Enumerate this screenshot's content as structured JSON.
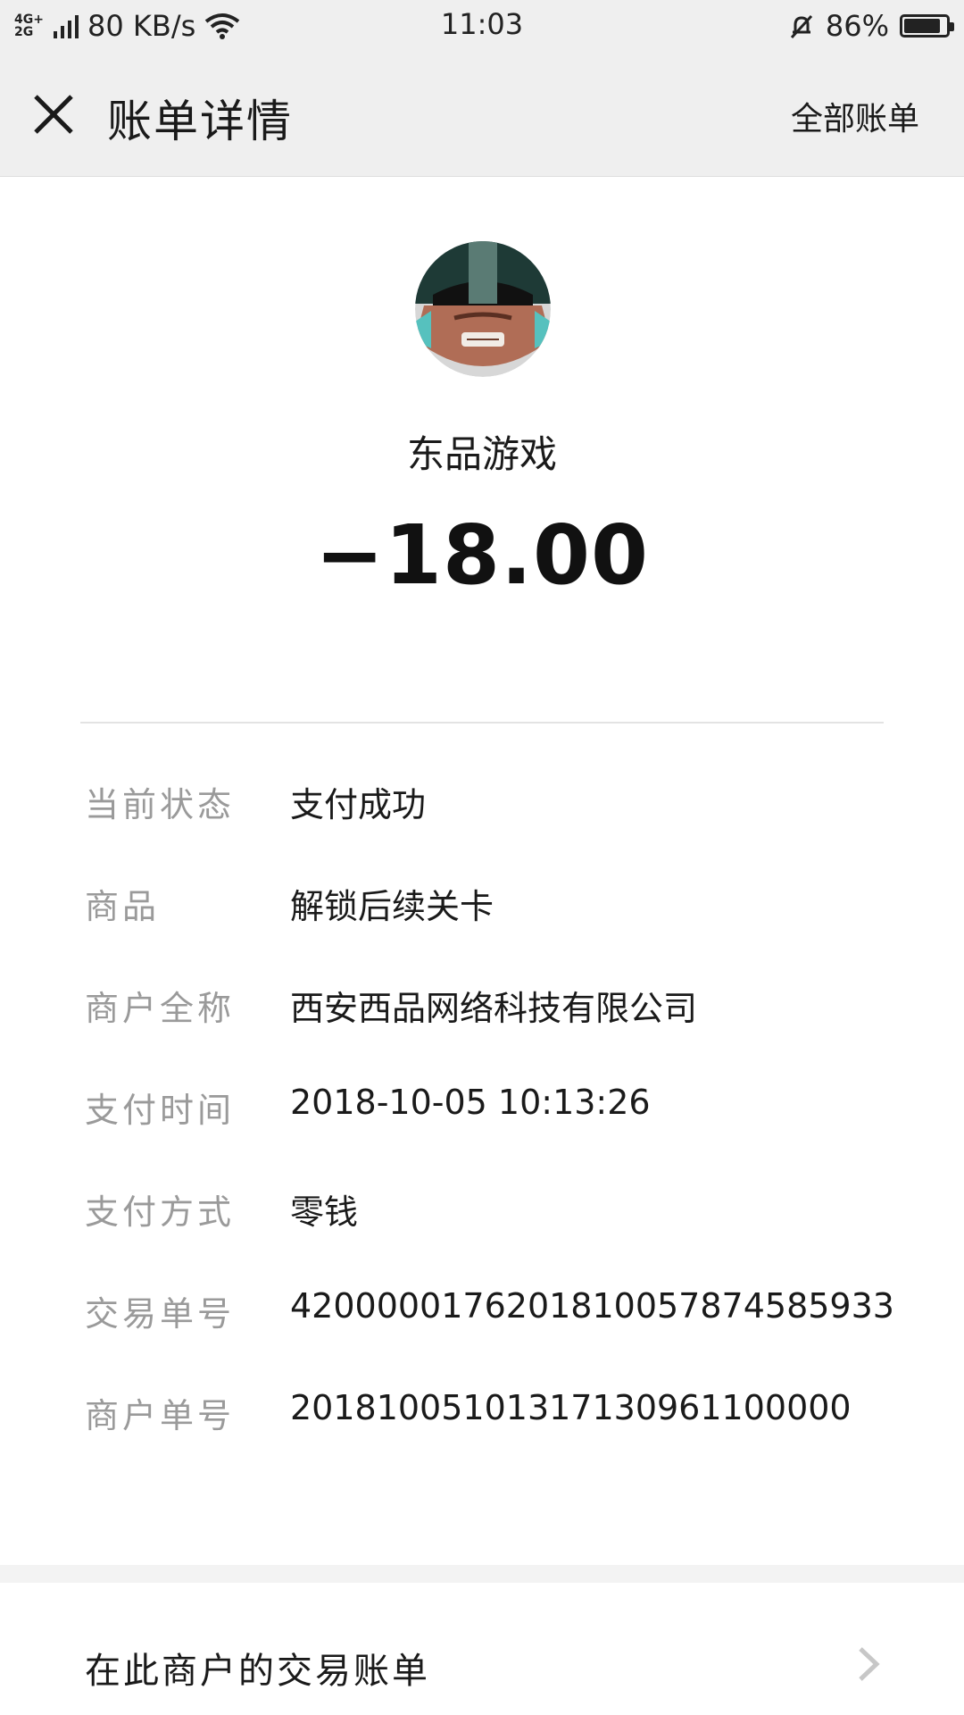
{
  "status_bar": {
    "network_top": "4G+",
    "network_bottom": "2G",
    "speed": "80 KB/s",
    "time": "11:03",
    "battery_percent": "86%",
    "battery_level": 0.86,
    "icons": [
      "signal-icon",
      "wifi-icon",
      "mute-bell-icon",
      "battery-icon"
    ]
  },
  "nav": {
    "title": "账单详情",
    "all_bills": "全部账单",
    "close_icon": "close-icon"
  },
  "merchant": {
    "name": "东品游戏",
    "amount": "−18.00",
    "avatar_icon": "merchant-avatar"
  },
  "details": [
    {
      "label": "当前状态",
      "value": "支付成功"
    },
    {
      "label": "商品",
      "value": "解锁后续关卡"
    },
    {
      "label": "商户全称",
      "value": "西安西品网络科技有限公司"
    },
    {
      "label": "支付时间",
      "value": "2018-10-05 10:13:26"
    },
    {
      "label": "支付方式",
      "value": "零钱"
    },
    {
      "label": "交易单号",
      "value": "4200000176201810057874585933"
    },
    {
      "label": "商户单号",
      "value": "20181005101317130961100000"
    }
  ],
  "footer": {
    "link_text": "在此商户的交易账单",
    "chevron_icon": "chevron-right-icon"
  },
  "colors": {
    "bar_bg": "#efefef",
    "label_gray": "#9a9a9a",
    "text": "#1a1a1a"
  }
}
